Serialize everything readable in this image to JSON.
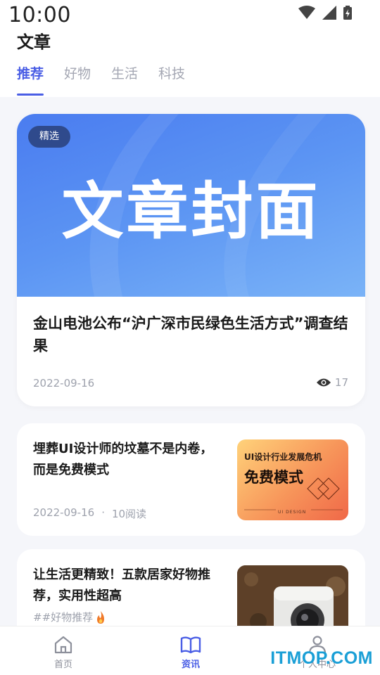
{
  "status_bar": {
    "time": "10:00",
    "icons": [
      "wifi-icon",
      "signal-icon",
      "battery-icon"
    ]
  },
  "header": {
    "title": "文章",
    "tabs": [
      {
        "label": "推荐",
        "active": true
      },
      {
        "label": "好物",
        "active": false
      },
      {
        "label": "生活",
        "active": false
      },
      {
        "label": "科技",
        "active": false
      }
    ]
  },
  "featured": {
    "badge": "精选",
    "cover_text": "文章封面",
    "title": "金山电池公布“沪广深市民绿色生活方式”调查结果",
    "date": "2022-09-16",
    "views": "17"
  },
  "articles": [
    {
      "title": "埋葬UI设计师的坟墓不是内卷，而是免费模式",
      "date": "2022-09-16",
      "separator": "·",
      "reads": "10阅读",
      "thumb_line1": "UI设计行业发展危机",
      "thumb_line2": "免费模式",
      "thumb_line3": "UI DESIGN"
    },
    {
      "title": "让生活更精致！五款居家好物推荐，实用性超高",
      "tag": "##好物推荐",
      "tag_icon": "fire-icon"
    }
  ],
  "bottom_nav": [
    {
      "label": "首页",
      "icon": "home-icon",
      "active": false
    },
    {
      "label": "资讯",
      "icon": "book-icon",
      "active": true
    },
    {
      "label": "个人中心",
      "icon": "user-icon",
      "active": false
    }
  ],
  "watermark": "ITMOP.COM",
  "colors": {
    "accent": "#4a5ee5",
    "badge_bg": "#2f4a8c",
    "muted_text": "#9ea2ad",
    "watermark": "#1a9fd6"
  }
}
